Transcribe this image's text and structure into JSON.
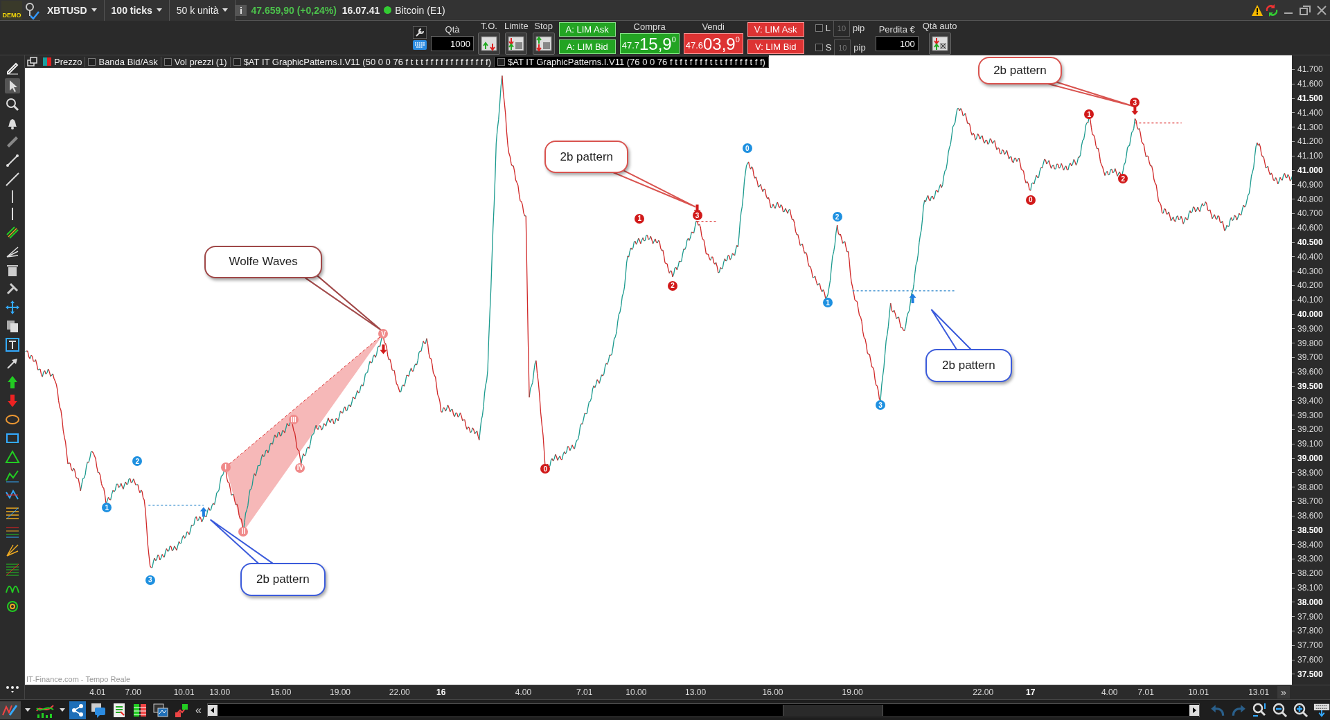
{
  "top_bar": {
    "logo": "DEMO",
    "symbol": "XBTUSD",
    "interval": "100 ticks",
    "volume_unit": "50 k unità",
    "price": "47.659,90 (+0,24%)",
    "time": "16.07.41",
    "instrument": "Bitcoin (E1)"
  },
  "order_bar": {
    "qty_label": "Qtà",
    "qty": "1000",
    "to_label": "T.O.",
    "limit_label": "Limite",
    "stop_label": "Stop",
    "buy_lim_ask": "A: LIM Ask",
    "buy_lim_bid": "A: LIM Bid",
    "buy_label": "Compra",
    "buy_price": {
      "prefix": "47.7",
      "main": "15,9",
      "sup": "0"
    },
    "sell_label": "Vendi",
    "sell_price": {
      "prefix": "47.6",
      "main": "03,9",
      "sup": "0"
    },
    "sell_lim_ask": "V: LIM Ask",
    "sell_lim_bid": "V: LIM Bid",
    "pip_rows": [
      {
        "label": "L",
        "checked": false,
        "value": "10",
        "unit": "pip"
      },
      {
        "label": "S",
        "checked": false,
        "value": "10",
        "unit": "pip"
      }
    ],
    "loss_label": "Perdita €",
    "loss": "100",
    "auto_qty_label": "Qtà auto"
  },
  "legend": [
    {
      "label": "Prezzo",
      "kind": "swatch",
      "checked": true
    },
    {
      "label": "Banda Bid/Ask",
      "kind": "checkbox",
      "checked": false
    },
    {
      "label": "Vol prezzi (1)",
      "kind": "checkbox",
      "checked": false
    },
    {
      "label": "$AT IT GraphicPatterns.I.V11 (50 0 0 76 f t t t f f f f f f f f f f f f f)",
      "kind": "checkbox",
      "checked": false
    },
    {
      "label": "$AT IT GraphicPatterns.I.V11 (76 0 0 76 f t f t f f f f t t t f f f f f t f f)",
      "kind": "checkbox",
      "checked": false
    }
  ],
  "callouts": [
    {
      "text": "2b pattern",
      "color": "#d9534f"
    },
    {
      "text": "2b pattern",
      "color": "#d9534f"
    },
    {
      "text": "Wolfe Waves",
      "color": "#a04848"
    },
    {
      "text": "2b pattern",
      "color": "#3b5bdb"
    },
    {
      "text": "2b pattern",
      "color": "#3b5bdb"
    }
  ],
  "markers": [
    {
      "label": "1",
      "color": "#1e90e0"
    },
    {
      "label": "2",
      "color": "#1e90e0"
    },
    {
      "label": "3",
      "color": "#1e90e0"
    },
    {
      "label": "0",
      "color": "#d11a1a"
    },
    {
      "label": "1",
      "color": "#d11a1a"
    },
    {
      "label": "2",
      "color": "#d11a1a"
    },
    {
      "label": "3",
      "color": "#d11a1a"
    },
    {
      "label": "0",
      "color": "#1e90e0"
    },
    {
      "label": "2",
      "color": "#1e90e0"
    },
    {
      "label": "1",
      "color": "#1e90e0"
    },
    {
      "label": "3",
      "color": "#1e90e0"
    },
    {
      "label": "0",
      "color": "#d11a1a"
    },
    {
      "label": "1",
      "color": "#d11a1a"
    },
    {
      "label": "2",
      "color": "#d11a1a"
    },
    {
      "label": "3",
      "color": "#d11a1a"
    },
    {
      "label": "I",
      "color": "#f08a8a"
    },
    {
      "label": "II",
      "color": "#f08a8a"
    },
    {
      "label": "III",
      "color": "#f08a8a"
    },
    {
      "label": "IV",
      "color": "#f08a8a"
    },
    {
      "label": "V",
      "color": "#f08a8a"
    }
  ],
  "watermark": "IT-Finance.com - Tempo Reale",
  "price_axis": [
    {
      "label": "41.700",
      "major": false
    },
    {
      "label": "41.600",
      "major": false
    },
    {
      "label": "41.500",
      "major": true
    },
    {
      "label": "41.400",
      "major": false
    },
    {
      "label": "41.300",
      "major": false
    },
    {
      "label": "41.200",
      "major": false
    },
    {
      "label": "41.100",
      "major": false
    },
    {
      "label": "41.000",
      "major": true
    },
    {
      "label": "40.900",
      "major": false
    },
    {
      "label": "40.800",
      "major": false
    },
    {
      "label": "40.700",
      "major": false
    },
    {
      "label": "40.600",
      "major": false
    },
    {
      "label": "40.500",
      "major": true
    },
    {
      "label": "40.400",
      "major": false
    },
    {
      "label": "40.300",
      "major": false
    },
    {
      "label": "40.200",
      "major": false
    },
    {
      "label": "40.100",
      "major": false
    },
    {
      "label": "40.000",
      "major": true
    },
    {
      "label": "39.900",
      "major": false
    },
    {
      "label": "39.800",
      "major": false
    },
    {
      "label": "39.700",
      "major": false
    },
    {
      "label": "39.600",
      "major": false
    },
    {
      "label": "39.500",
      "major": true
    },
    {
      "label": "39.400",
      "major": false
    },
    {
      "label": "39.300",
      "major": false
    },
    {
      "label": "39.200",
      "major": false
    },
    {
      "label": "39.100",
      "major": false
    },
    {
      "label": "39.000",
      "major": true
    },
    {
      "label": "38.900",
      "major": false
    },
    {
      "label": "38.800",
      "major": false
    },
    {
      "label": "38.700",
      "major": false
    },
    {
      "label": "38.600",
      "major": false
    },
    {
      "label": "38.500",
      "major": true
    },
    {
      "label": "38.400",
      "major": false
    },
    {
      "label": "38.300",
      "major": false
    },
    {
      "label": "38.200",
      "major": false
    },
    {
      "label": "38.100",
      "major": false
    },
    {
      "label": "38.000",
      "major": true
    },
    {
      "label": "37.900",
      "major": false
    },
    {
      "label": "37.800",
      "major": false
    },
    {
      "label": "37.700",
      "major": false
    },
    {
      "label": "37.600",
      "major": false
    },
    {
      "label": "37.500",
      "major": true
    }
  ],
  "time_axis": [
    {
      "label": "4.01",
      "major": false
    },
    {
      "label": "7.00",
      "major": false
    },
    {
      "label": "10.01",
      "major": false
    },
    {
      "label": "13.00",
      "major": false
    },
    {
      "label": "16.00",
      "major": false
    },
    {
      "label": "19.00",
      "major": false
    },
    {
      "label": "22.00",
      "major": false
    },
    {
      "label": "16",
      "major": true
    },
    {
      "label": "4.00",
      "major": false
    },
    {
      "label": "7.01",
      "major": false
    },
    {
      "label": "10.00",
      "major": false
    },
    {
      "label": "13.00",
      "major": false
    },
    {
      "label": "16.00",
      "major": false
    },
    {
      "label": "19.00",
      "major": false
    },
    {
      "label": "22.00",
      "major": false
    },
    {
      "label": "17",
      "major": true
    },
    {
      "label": "4.00",
      "major": false
    },
    {
      "label": "7.01",
      "major": false
    },
    {
      "label": "10.01",
      "major": false
    },
    {
      "label": "13.01",
      "major": false
    }
  ],
  "time_axis_more": "»",
  "bottom_bar": {
    "collapse": "«"
  }
}
